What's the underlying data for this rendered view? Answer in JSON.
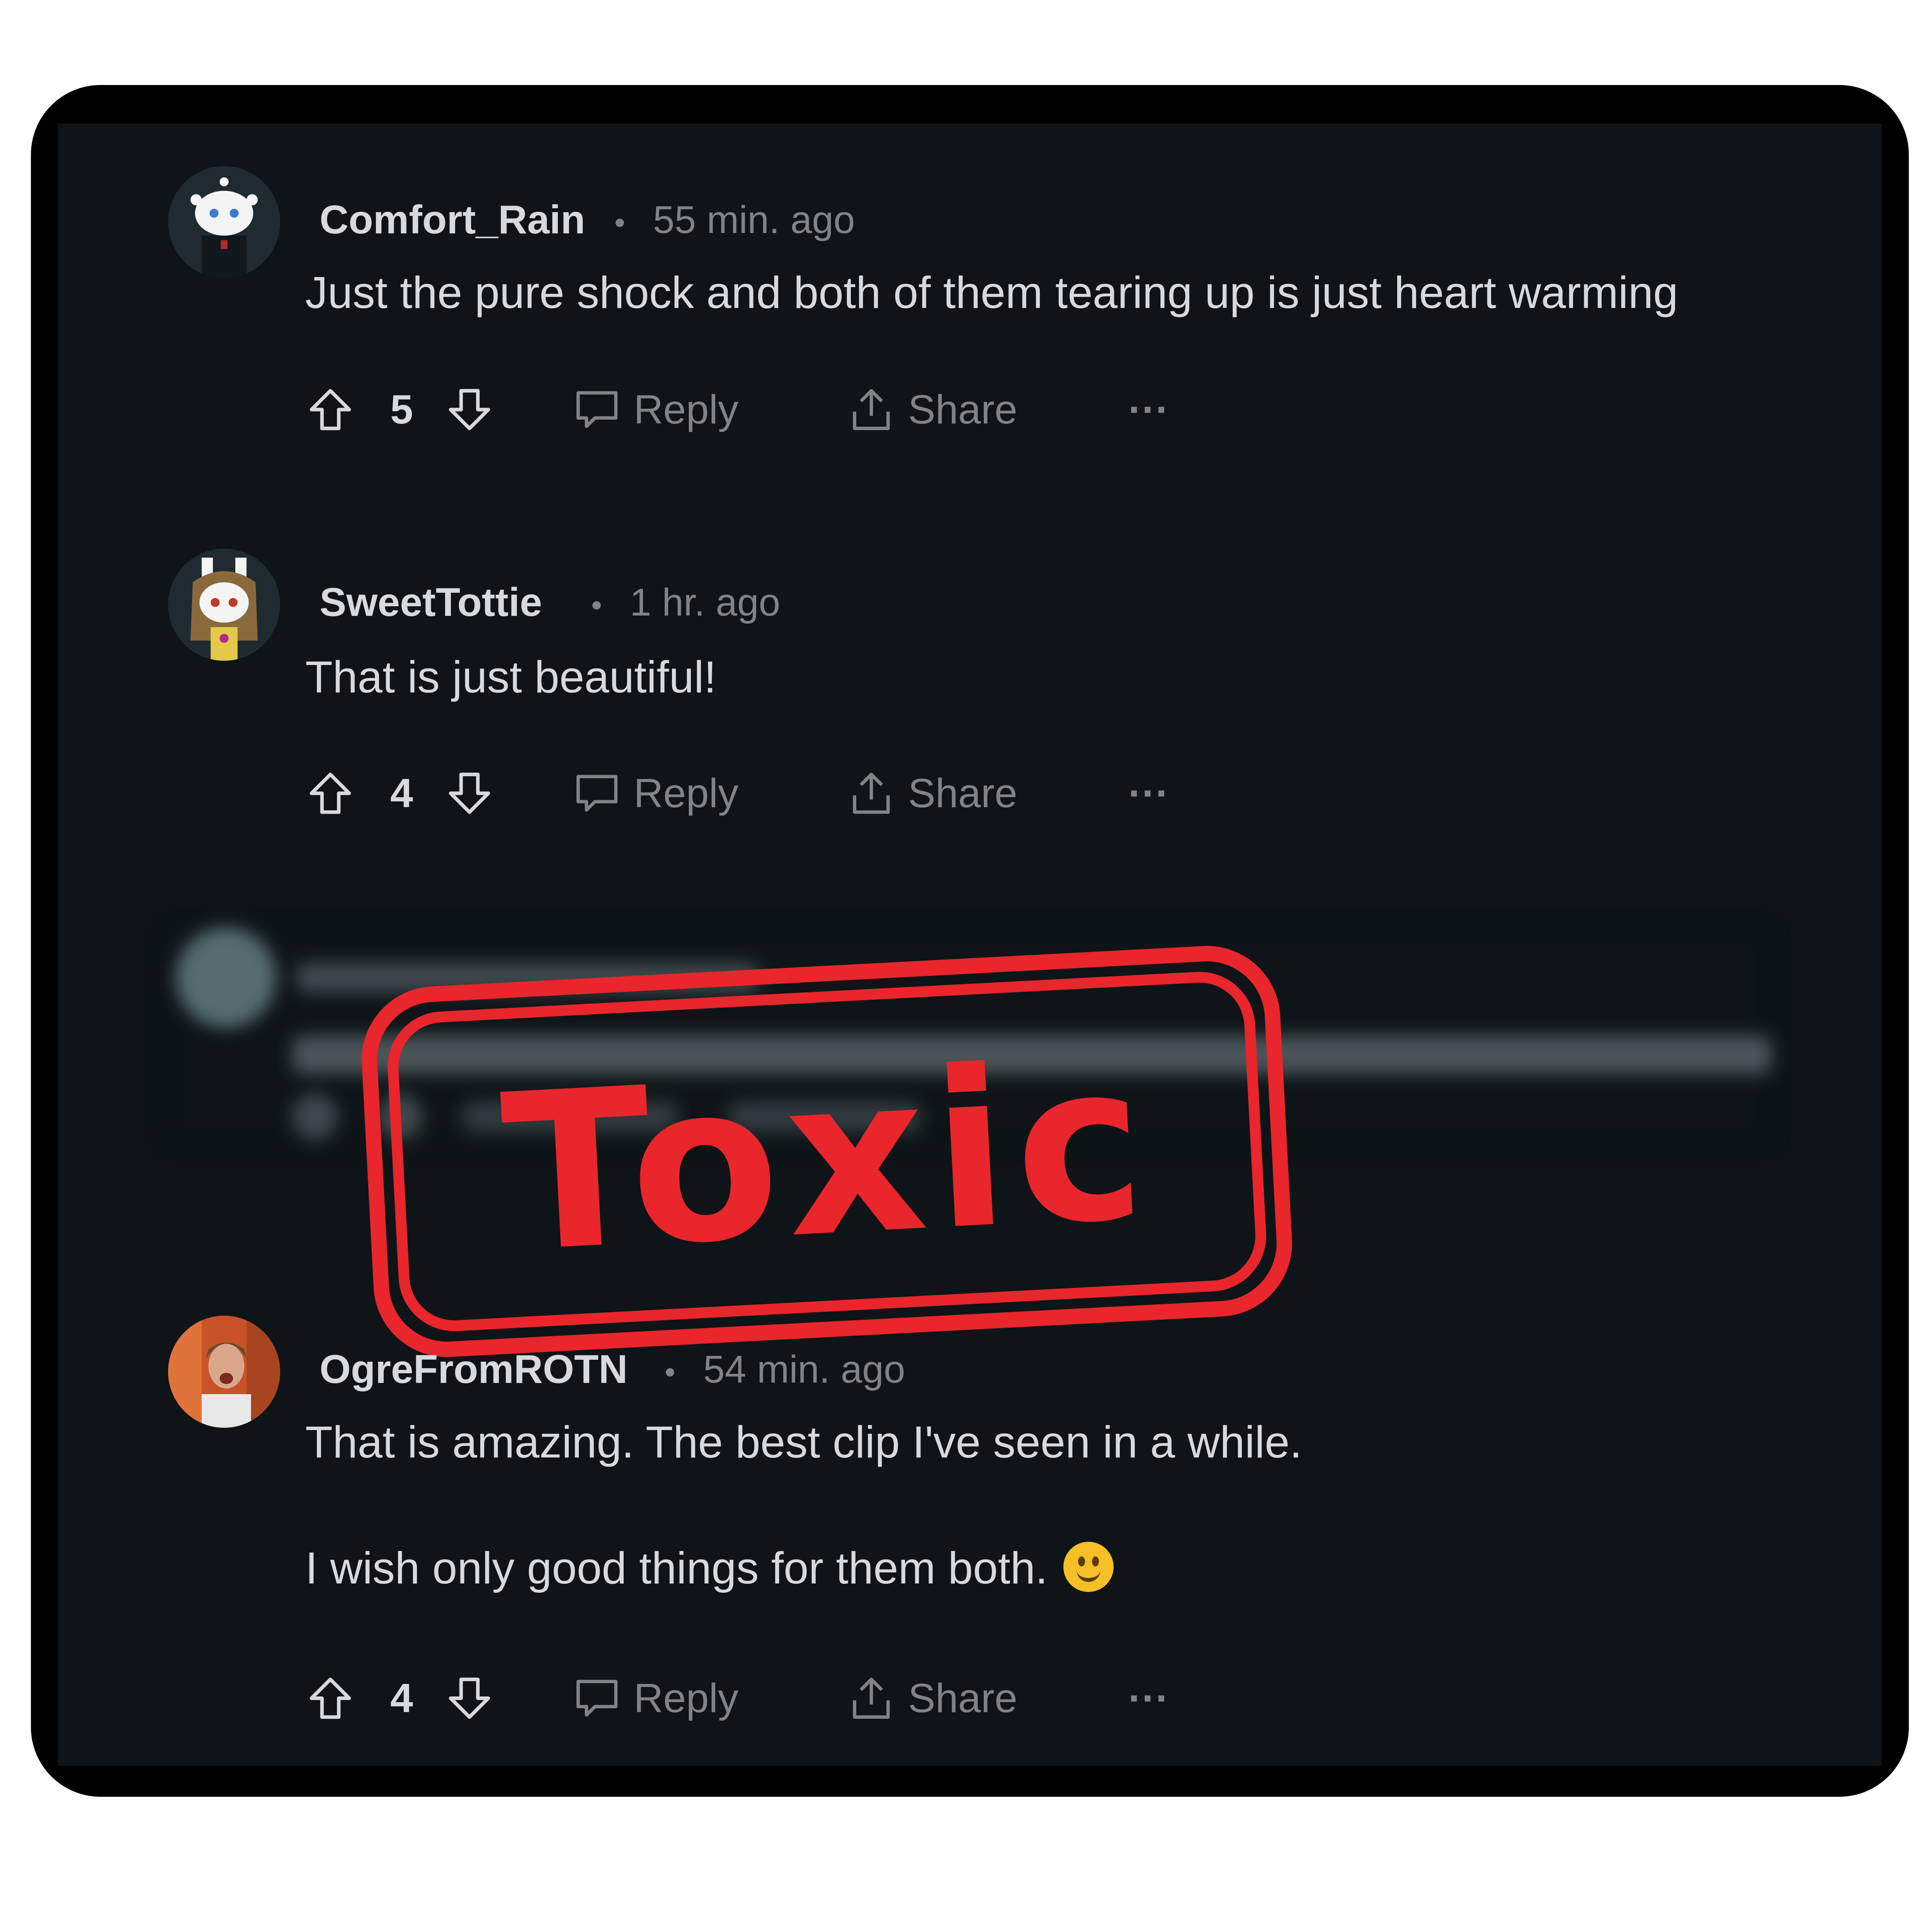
{
  "comments": [
    {
      "username": "Comfort_Rain",
      "time": "55 min. ago",
      "body": [
        "Just the pure shock and both of them tearing up is just heart warming"
      ],
      "votes": "5"
    },
    {
      "username": "SweetTottie",
      "time": "1 hr. ago",
      "body": [
        "That is just beautiful!"
      ],
      "votes": "4"
    },
    {
      "username": "OgreFromROTN",
      "time": "54 min. ago",
      "body": [
        "That is amazing. The best clip I've seen in a while.",
        "I wish only good things for them both."
      ],
      "votes": "4"
    }
  ],
  "actions": {
    "reply_label": "Reply",
    "share_label": "Share",
    "more_label": "···"
  },
  "stamp": {
    "text": "Toxic",
    "color": "#e8262b"
  },
  "colors": {
    "background": "#0e1417",
    "frame": "#000000",
    "text": "#d7dadc",
    "muted": "#818384"
  }
}
